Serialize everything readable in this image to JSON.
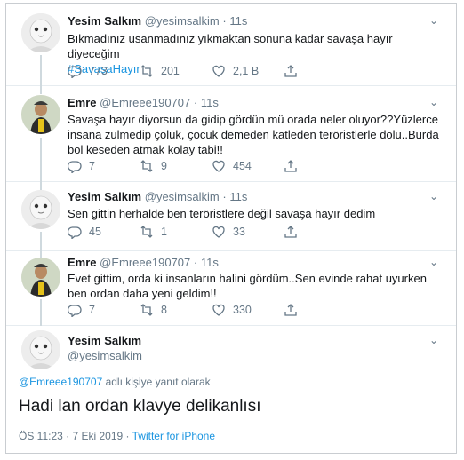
{
  "tweets": [
    {
      "name": "Yesim Salkım",
      "handle": "@yesimsalkim",
      "time": "11s",
      "text": "Bıkmadınız usanmadınız yıkmaktan sonuna kadar savaşa hayır diyeceğim",
      "hashtag": "#SavaşaHayır",
      "replies": "773",
      "retweets": "201",
      "likes": "2,1 B"
    },
    {
      "name": "Emre",
      "handle": "@Emreee190707",
      "time": "11s",
      "text": "Savaşa hayır diyorsun da gidip gördün mü orada neler oluyor??Yüzlerce insana zulmedip çoluk, çocuk demeden katleden teröristlerle dolu..Burda bol keseden atmak kolay tabi!!",
      "replies": "7",
      "retweets": "9",
      "likes": "454"
    },
    {
      "name": "Yesim Salkım",
      "handle": "@yesimsalkim",
      "time": "11s",
      "text": "Sen gittin herhalde ben teröristlere değil savaşa hayır dedim",
      "replies": "45",
      "retweets": "1",
      "likes": "33"
    },
    {
      "name": "Emre",
      "handle": "@Emreee190707",
      "time": "11s",
      "text": "Evet gittim, orda ki insanların halini gördüm..Sen evinde rahat uyurken ben ordan daha yeni geldim!!",
      "replies": "7",
      "retweets": "8",
      "likes": "330"
    }
  ],
  "main_tweet": {
    "name": "Yesim Salkım",
    "handle": "@yesimsalkim",
    "reply_mention": "@Emreee190707",
    "reply_suffix": " adlı kişiye yanıt olarak",
    "text": "Hadi lan ordan klavye delikanlısı",
    "timestamp": "ÖS 11:23 · 7 Eki 2019 · ",
    "source": "Twitter for iPhone"
  },
  "separator": "·",
  "colors": {
    "link": "#1b95e0",
    "muted": "#657786",
    "text": "#14171a"
  }
}
